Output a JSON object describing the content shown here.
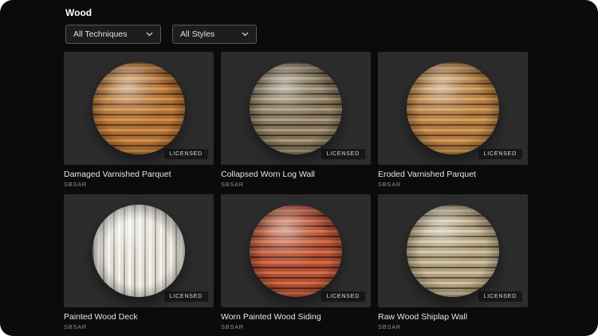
{
  "page": {
    "title": "Wood"
  },
  "filters": {
    "techniques": {
      "value": "All Techniques"
    },
    "styles": {
      "value": "All Styles"
    }
  },
  "colors": {
    "screen_background": "#0b0b0b",
    "tile_background": "#2c2c2c",
    "title_text": "#e6e6e6",
    "format_text": "#8f8f8f"
  },
  "cards": [
    {
      "title": "Damaged Varnished Parquet",
      "format": "SBSAR",
      "badge": "LICENSED",
      "sphere_style": "--light:#d2924e;--base:#b06f33;--dark:#5f3a1c;--dir:to bottom"
    },
    {
      "title": "Collapsed Worn Log Wall",
      "format": "SBSAR",
      "badge": "LICENSED",
      "sphere_style": "--light:#ab9d80;--base:#84735a;--dark:#3f352a;--dir:to bottom"
    },
    {
      "title": "Eroded Varnished Parquet",
      "format": "SBSAR",
      "badge": "LICENSED",
      "sphere_style": "--light:#d49e5e;--base:#b27b40;--dark:#64401f;--dir:to bottom"
    },
    {
      "title": "Painted Wood Deck",
      "format": "SBSAR",
      "badge": "LICENSED",
      "sphere_style": "--light:#f4f2ec;--base:#e0ddd5;--dark:#a29d92;--dir:to right"
    },
    {
      "title": "Worn Painted Wood Siding",
      "format": "SBSAR",
      "badge": "LICENSED",
      "sphere_style": "--light:#d2714c;--base:#b14f34;--dark:#5c2516;--dir:to bottom"
    },
    {
      "title": "Raw Wood Shiplap Wall",
      "format": "SBSAR",
      "badge": "LICENSED",
      "sphere_style": "--light:#d1c4a2;--base:#ae9f7d;--dark:#5a4e36;--dir:to bottom"
    }
  ]
}
